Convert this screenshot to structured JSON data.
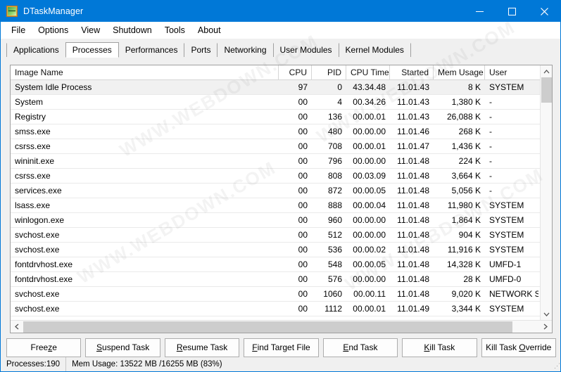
{
  "window": {
    "title": "DTaskManager",
    "icon": "waveform-icon",
    "accent_color": "#0078d7",
    "controls": {
      "minimize": "minimize-icon",
      "maximize": "maximize-icon",
      "close": "close-icon"
    }
  },
  "menu": {
    "items": [
      {
        "label": "File"
      },
      {
        "label": "Options"
      },
      {
        "label": "View"
      },
      {
        "label": "Shutdown"
      },
      {
        "label": "Tools"
      },
      {
        "label": "About"
      }
    ]
  },
  "tabs": {
    "active": "Processes",
    "items": [
      {
        "label": "Applications"
      },
      {
        "label": "Processes"
      },
      {
        "label": "Performances"
      },
      {
        "label": "Ports"
      },
      {
        "label": "Networking"
      },
      {
        "label": "User Modules"
      },
      {
        "label": "Kernel Modules"
      }
    ]
  },
  "table": {
    "columns": [
      {
        "label": "Image Name"
      },
      {
        "label": "CPU"
      },
      {
        "label": "PID"
      },
      {
        "label": "CPU Time"
      },
      {
        "label": "Started"
      },
      {
        "label": "Mem Usage"
      },
      {
        "label": "User"
      }
    ],
    "rows": [
      {
        "image_name": "System Idle Process",
        "cpu": "97",
        "pid": "0",
        "cpu_time": "43.34.48",
        "started": "11.01.43",
        "mem_usage": "8 K",
        "user": "SYSTEM",
        "selected": true
      },
      {
        "image_name": "System",
        "cpu": "00",
        "pid": "4",
        "cpu_time": "00.34.26",
        "started": "11.01.43",
        "mem_usage": "1,380 K",
        "user": "-",
        "selected": false
      },
      {
        "image_name": "Registry",
        "cpu": "00",
        "pid": "136",
        "cpu_time": "00.00.01",
        "started": "11.01.43",
        "mem_usage": "26,088 K",
        "user": "-",
        "selected": false
      },
      {
        "image_name": "smss.exe",
        "cpu": "00",
        "pid": "480",
        "cpu_time": "00.00.00",
        "started": "11.01.46",
        "mem_usage": "268 K",
        "user": "-",
        "selected": false
      },
      {
        "image_name": "csrss.exe",
        "cpu": "00",
        "pid": "708",
        "cpu_time": "00.00.01",
        "started": "11.01.47",
        "mem_usage": "1,436 K",
        "user": "-",
        "selected": false
      },
      {
        "image_name": "wininit.exe",
        "cpu": "00",
        "pid": "796",
        "cpu_time": "00.00.00",
        "started": "11.01.48",
        "mem_usage": "224 K",
        "user": "-",
        "selected": false
      },
      {
        "image_name": "csrss.exe",
        "cpu": "00",
        "pid": "808",
        "cpu_time": "00.03.09",
        "started": "11.01.48",
        "mem_usage": "3,664 K",
        "user": "-",
        "selected": false
      },
      {
        "image_name": "services.exe",
        "cpu": "00",
        "pid": "872",
        "cpu_time": "00.00.05",
        "started": "11.01.48",
        "mem_usage": "5,056 K",
        "user": "-",
        "selected": false
      },
      {
        "image_name": "lsass.exe",
        "cpu": "00",
        "pid": "888",
        "cpu_time": "00.00.04",
        "started": "11.01.48",
        "mem_usage": "11,980 K",
        "user": "SYSTEM",
        "selected": false
      },
      {
        "image_name": "winlogon.exe",
        "cpu": "00",
        "pid": "960",
        "cpu_time": "00.00.00",
        "started": "11.01.48",
        "mem_usage": "1,864 K",
        "user": "SYSTEM",
        "selected": false
      },
      {
        "image_name": "svchost.exe",
        "cpu": "00",
        "pid": "512",
        "cpu_time": "00.00.00",
        "started": "11.01.48",
        "mem_usage": "904 K",
        "user": "SYSTEM",
        "selected": false
      },
      {
        "image_name": "svchost.exe",
        "cpu": "00",
        "pid": "536",
        "cpu_time": "00.00.02",
        "started": "11.01.48",
        "mem_usage": "11,916 K",
        "user": "SYSTEM",
        "selected": false
      },
      {
        "image_name": "fontdrvhost.exe",
        "cpu": "00",
        "pid": "548",
        "cpu_time": "00.00.05",
        "started": "11.01.48",
        "mem_usage": "14,328 K",
        "user": "UMFD-1",
        "selected": false
      },
      {
        "image_name": "fontdrvhost.exe",
        "cpu": "00",
        "pid": "576",
        "cpu_time": "00.00.00",
        "started": "11.01.48",
        "mem_usage": "28 K",
        "user": "UMFD-0",
        "selected": false
      },
      {
        "image_name": "svchost.exe",
        "cpu": "00",
        "pid": "1060",
        "cpu_time": "00.00.11",
        "started": "11.01.48",
        "mem_usage": "9,020 K",
        "user": "NETWORK SER",
        "selected": false
      },
      {
        "image_name": "svchost.exe",
        "cpu": "00",
        "pid": "1112",
        "cpu_time": "00.00.01",
        "started": "11.01.49",
        "mem_usage": "3,344 K",
        "user": "SYSTEM",
        "selected": false
      }
    ]
  },
  "scrollbars": {
    "vertical": {
      "up": "chevron-up-icon",
      "down": "chevron-down-icon"
    },
    "horizontal": {
      "left": "chevron-left-icon",
      "right": "chevron-right-icon"
    }
  },
  "buttons": [
    {
      "label": "Freeze",
      "accel": "z"
    },
    {
      "label": "Suspend Task",
      "accel": "S"
    },
    {
      "label": "Resume Task",
      "accel": "R"
    },
    {
      "label": "Find Target File",
      "accel": "F"
    },
    {
      "label": "End Task",
      "accel": "E"
    },
    {
      "label": "Kill Task",
      "accel": "K"
    },
    {
      "label": "Kill Task Override",
      "accel": "O"
    }
  ],
  "statusbar": {
    "processes": "Processes:190",
    "memory": "Mem Usage: 13522 MB /16255 MB (83%)"
  },
  "watermarks": [
    "WWW.WEBDOWN.COM",
    "WWW.WEBDOWN.COM",
    "WWW.WEBDOWN.COM",
    "WWW.WEBDOWN.COM"
  ]
}
